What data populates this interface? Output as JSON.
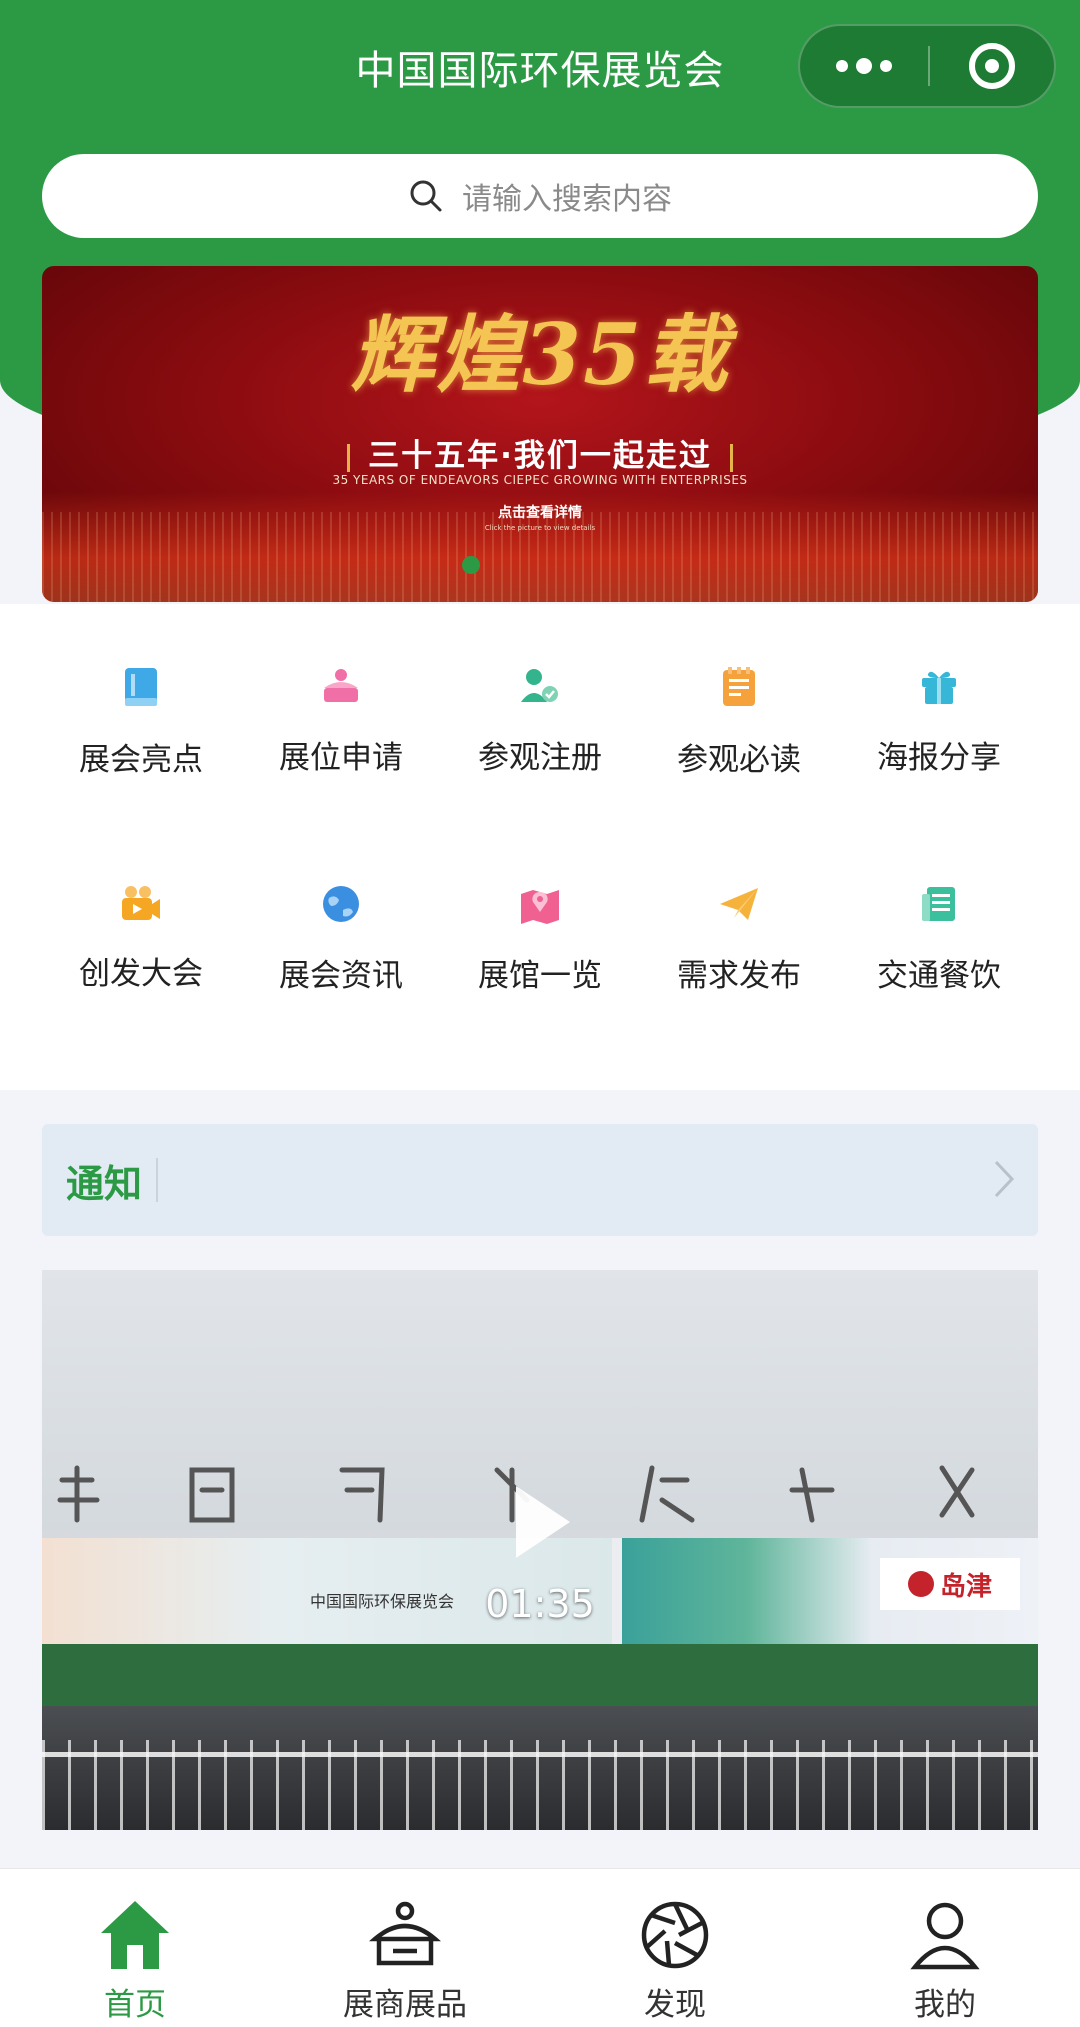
{
  "header": {
    "title": "中国国际环保展览会",
    "capsule": {
      "more_icon": "more-dots-icon",
      "close_icon": "target-close-icon"
    }
  },
  "search": {
    "placeholder": "请输入搜索内容",
    "icon": "search-icon"
  },
  "banner": {
    "headline": "辉煌35载",
    "subtitle": "三十五年·我们一起走过",
    "english": "35 YEARS OF ENDEAVORS CIEPEC GROWING WITH ENTERPRISES",
    "cta": "点击查看详情",
    "cta_en": "Click the picture to view details",
    "active_dot": 1,
    "total_dots": 1
  },
  "menu": {
    "items": [
      {
        "label": "展会亮点",
        "icon": "book-icon",
        "color": "#3fa9e8"
      },
      {
        "label": "展位申请",
        "icon": "booth-icon",
        "color": "#f06fa6"
      },
      {
        "label": "参观注册",
        "icon": "user-register-icon",
        "color": "#33b48c"
      },
      {
        "label": "参观必读",
        "icon": "notepad-icon",
        "color": "#f5a23c"
      },
      {
        "label": "海报分享",
        "icon": "gift-icon",
        "color": "#36b7d8"
      },
      {
        "label": "创发大会",
        "icon": "video-camera-icon",
        "color": "#f5a623"
      },
      {
        "label": "展会资讯",
        "icon": "globe-icon",
        "color": "#3b8fe0"
      },
      {
        "label": "展馆一览",
        "icon": "map-pin-icon",
        "color": "#f06090"
      },
      {
        "label": "需求发布",
        "icon": "paper-plane-icon",
        "color": "#f5b33c"
      },
      {
        "label": "交通餐饮",
        "icon": "newspaper-icon",
        "color": "#3bbf9c"
      }
    ]
  },
  "notice": {
    "title": "通知",
    "chevron": "chevron-right-icon"
  },
  "video": {
    "duration": "01:35",
    "facade_text": "中国国际环保展览会",
    "brand": "岛津",
    "play_icon": "play-icon"
  },
  "tabbar": {
    "items": [
      {
        "label": "首页",
        "icon": "home-icon",
        "active": true
      },
      {
        "label": "展商展品",
        "icon": "exhibitor-icon",
        "active": false
      },
      {
        "label": "发现",
        "icon": "aperture-icon",
        "active": false
      },
      {
        "label": "我的",
        "icon": "person-icon",
        "active": false
      }
    ]
  },
  "colors": {
    "brand_green": "#2c9a45",
    "active_tab": "#2c9a45"
  }
}
